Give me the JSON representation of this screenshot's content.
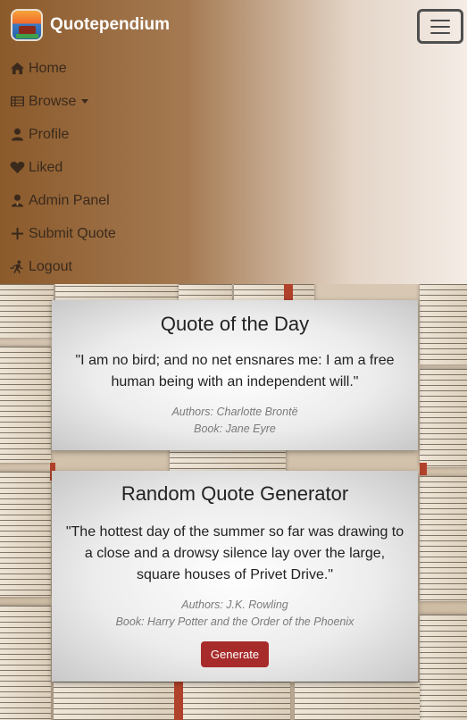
{
  "brand": {
    "name": "Quotependium",
    "logo_icon": "quotependium-logo-icon"
  },
  "nav": {
    "toggle_icon": "hamburger-icon",
    "items": [
      {
        "label": "Home",
        "icon": "home-icon"
      },
      {
        "label": "Browse",
        "icon": "list-icon",
        "dropdown": true
      },
      {
        "label": "Profile",
        "icon": "user-icon"
      },
      {
        "label": "Liked",
        "icon": "heart-icon"
      },
      {
        "label": "Admin Panel",
        "icon": "admin-user-icon"
      },
      {
        "label": "Submit Quote",
        "icon": "plus-icon"
      },
      {
        "label": "Logout",
        "icon": "logout-icon"
      }
    ]
  },
  "quote_of_the_day": {
    "title": "Quote of the Day",
    "quote": "\"I am no bird; and no net ensnares me: I am a free human being with an independent will.\"",
    "authors": "Authors: Charlotte Brontë",
    "book": "Book: Jane Eyre"
  },
  "random_quote": {
    "title": "Random Quote Generator",
    "quote": "\"The hottest day of the summer so far was drawing to a close and a drowsy silence lay over the large, square houses of Privet Drive.\"",
    "authors": "Authors: J.K. Rowling",
    "book": "Book: Harry Potter and the Order of the Phoenix",
    "button_label": "Generate"
  },
  "colors": {
    "navbar_start": "#8b5a2b",
    "navbar_end": "#f4ece6",
    "nav_text": "#3b2a1c",
    "button": "#a82b2b"
  }
}
